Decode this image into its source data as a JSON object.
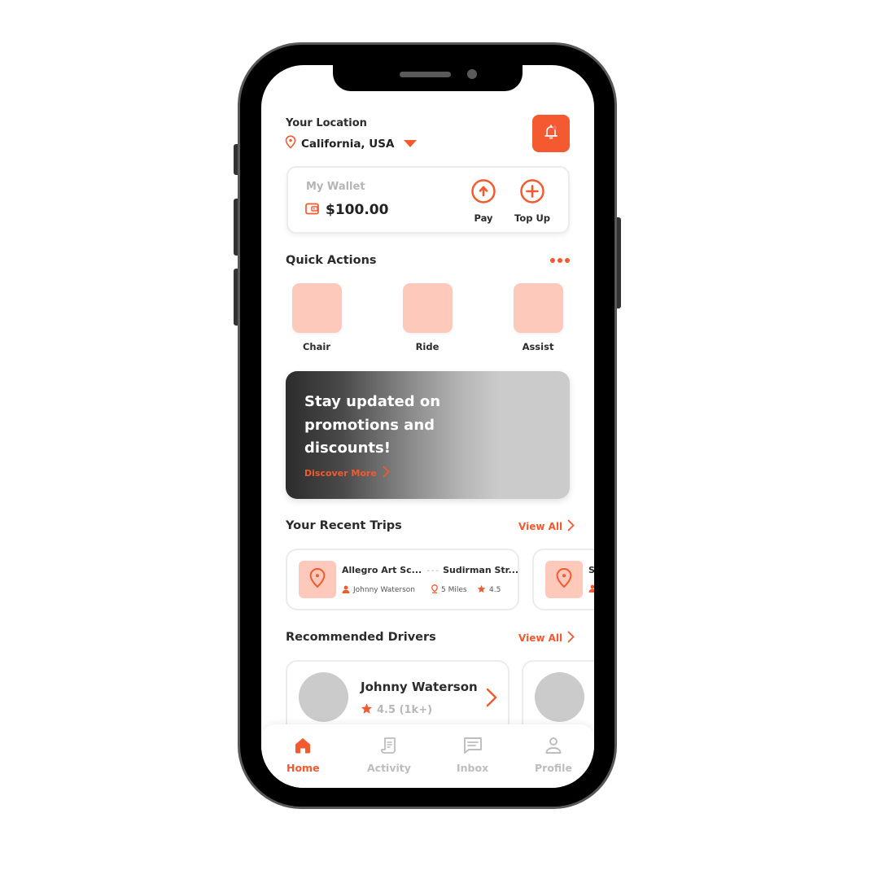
{
  "colors": {
    "accent": "#f4592f",
    "accent_light": "#fdc9bb",
    "text_dark": "#2b2b2b",
    "muted": "#bdbdbd",
    "placeholder_gray": "#cbcbcb"
  },
  "header": {
    "location_label": "Your Location",
    "location_value": "California, USA",
    "location_icon": "map-pin-icon",
    "dropdown_icon": "caret-down-icon",
    "notification_icon": "bell-icon",
    "notification_badge": true
  },
  "wallet": {
    "label": "My Wallet",
    "balance": "$100.00",
    "icon": "wallet-icon",
    "actions": [
      {
        "label": "Pay",
        "icon": "arrow-up-circle-icon"
      },
      {
        "label": "Top Up",
        "icon": "plus-circle-icon"
      }
    ]
  },
  "quick_actions": {
    "title": "Quick Actions",
    "more_icon": "more-dots-icon",
    "items": [
      {
        "label": "Chair"
      },
      {
        "label": "Ride"
      },
      {
        "label": "Assist"
      }
    ]
  },
  "promo": {
    "title": "Stay updated on promotions and discounts!",
    "link_label": "Discover More"
  },
  "recent_trips": {
    "title": "Your Recent Trips",
    "view_all": "View All",
    "trips": [
      {
        "from": "Allegro Art Sc...",
        "to": "Sudirman Str...",
        "driver": "Johnny Waterson",
        "distance": "5 Miles",
        "rating": "4.5"
      },
      {
        "from": "S",
        "to": "",
        "driver": "",
        "distance": "",
        "rating": ""
      }
    ]
  },
  "recommended_drivers": {
    "title": "Recommended Drivers",
    "view_all": "View All",
    "drivers": [
      {
        "name": "Johnny Waterson",
        "rating": "4.5 (1k+)"
      },
      {
        "name": "",
        "rating": ""
      }
    ]
  },
  "bottom_nav": {
    "active": "Home",
    "items": [
      {
        "label": "Home",
        "icon": "home-icon"
      },
      {
        "label": "Activity",
        "icon": "receipt-icon"
      },
      {
        "label": "Inbox",
        "icon": "message-icon"
      },
      {
        "label": "Profile",
        "icon": "user-icon"
      }
    ]
  }
}
